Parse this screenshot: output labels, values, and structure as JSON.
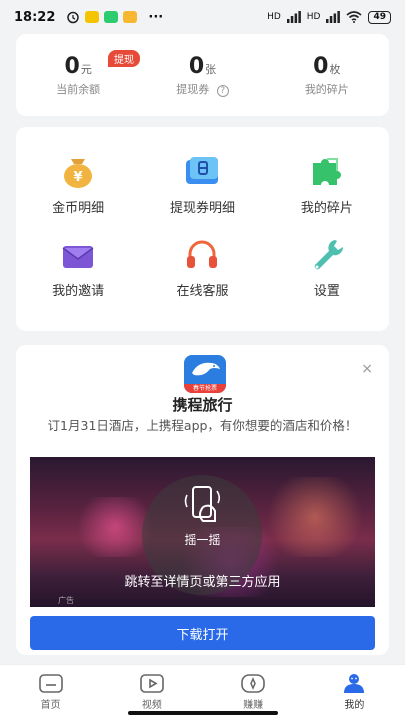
{
  "status_bar": {
    "time": "18:22",
    "network_1": "HD",
    "network_2": "HD",
    "battery": "49",
    "more": "···"
  },
  "stats": {
    "balance": {
      "value": "0",
      "unit": "元",
      "label": "当前余额",
      "tag": "提现"
    },
    "voucher": {
      "value": "0",
      "unit": "张",
      "label": "提现券",
      "help": "?"
    },
    "fragments": {
      "value": "0",
      "unit": "枚",
      "label": "我的碎片"
    }
  },
  "menu": {
    "items": [
      {
        "label": "金币明细",
        "icon": "money-bag-icon"
      },
      {
        "label": "提现券明细",
        "icon": "voucher-icon"
      },
      {
        "label": "我的碎片",
        "icon": "puzzle-icon"
      },
      {
        "label": "我的邀请",
        "icon": "envelope-icon"
      },
      {
        "label": "在线客服",
        "icon": "headphones-icon"
      },
      {
        "label": "设置",
        "icon": "wrench-icon"
      }
    ]
  },
  "ad": {
    "close": "×",
    "logo_badge": "春节抢票",
    "title": "携程旅行",
    "description": "订1月31日酒店，上携程app，有你想要的酒店和价格！",
    "shake_label": "摇一摇",
    "jump_text": "跳转至详情页或第三方应用",
    "ad_mark": "广告",
    "button": "下载打开"
  },
  "tabbar": {
    "tabs": [
      {
        "label": "首页",
        "icon": "home-icon"
      },
      {
        "label": "视频",
        "icon": "video-icon"
      },
      {
        "label": "赚赚",
        "icon": "earn-icon"
      },
      {
        "label": "我的",
        "icon": "profile-icon"
      }
    ],
    "active_index": 3
  },
  "colors": {
    "accent": "#2a6ae9",
    "tag_red": "#e84a3a",
    "active_tab": "#2a6ae9"
  }
}
